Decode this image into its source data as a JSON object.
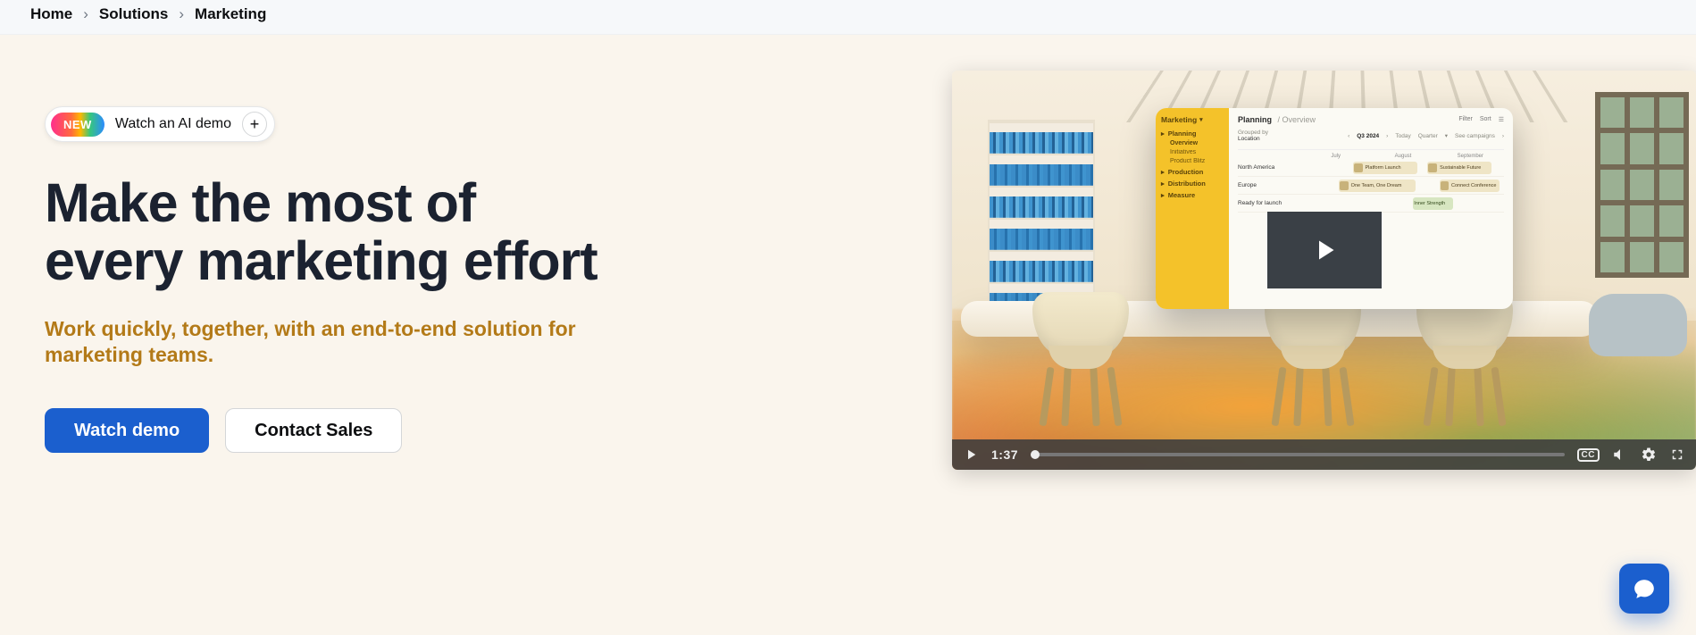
{
  "breadcrumb": {
    "home": "Home",
    "solutions": "Solutions",
    "current": "Marketing"
  },
  "ai_pill": {
    "badge": "NEW",
    "label": "Watch an AI demo"
  },
  "hero": {
    "title": "Make the most of every marketing effort",
    "subtitle": "Work quickly, together, with an end-to-end solution for marketing teams."
  },
  "cta": {
    "primary": "Watch demo",
    "secondary": "Contact Sales"
  },
  "video": {
    "time": "1:37",
    "cc_label": "CC"
  },
  "app_preview": {
    "workspace": "Marketing",
    "sidebar": {
      "planning": "Planning",
      "items": [
        "Overview",
        "Initiatives",
        "Product Blitz"
      ],
      "production": "Production",
      "distribution": "Distribution",
      "measure": "Measure"
    },
    "header": {
      "crumb": "Planning",
      "sub": "Overview",
      "filter": "Filter",
      "sort": "Sort"
    },
    "meta": {
      "grouped": "Grouped by",
      "grouped_value": "Location",
      "quarter": "Q3 2024",
      "today": "Today",
      "view": "Quarter",
      "campaigns": "See campaigns"
    },
    "months": [
      "July",
      "August",
      "September"
    ],
    "rows": {
      "r1": {
        "label": "North America"
      },
      "r2": {
        "label": "Europe"
      },
      "r3": {
        "label": "Ready for launch"
      }
    },
    "bars": {
      "platform_launch": "Platform Launch",
      "sustainable_future": "Sustainable Future",
      "one_team": "One Team, One Dream",
      "connect": "Connect Conference",
      "inner": "Inner Strength"
    }
  },
  "colors": {
    "primary_blue": "#1b5fce",
    "accent_amber": "#b37a18",
    "bg_cream": "#faf5ed"
  }
}
